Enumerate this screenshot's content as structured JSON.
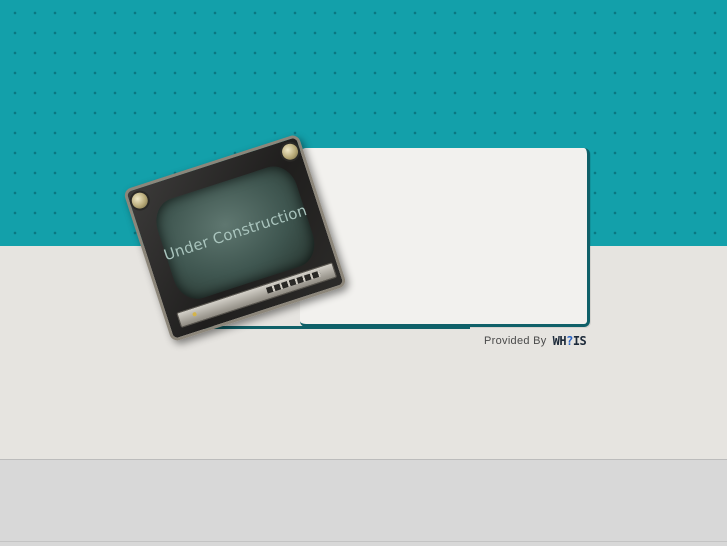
{
  "screen": {
    "title": "Under Construction"
  },
  "credit": {
    "label": "Provided By",
    "logo_text": "WH?IS"
  },
  "colors": {
    "top_band": "#13a0aa",
    "mid_band": "#e6e4e0",
    "bottom_band": "#d8d8d8",
    "card": "#f2f1ee",
    "card_border": "#0f6068"
  },
  "icons": {
    "tv": "retro-television-icon",
    "logo": "whois-logo"
  }
}
